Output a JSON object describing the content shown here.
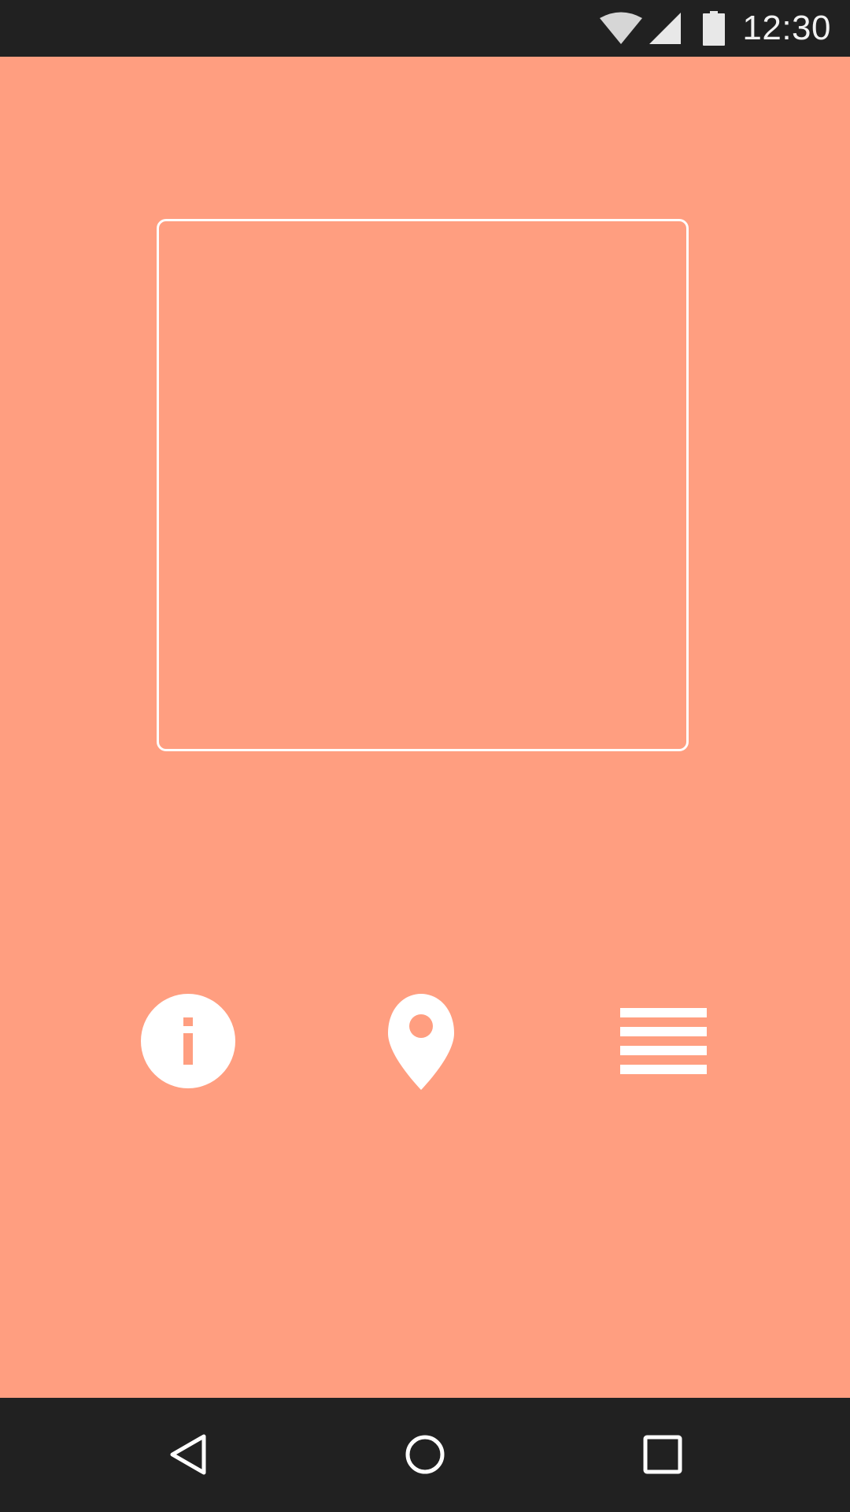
{
  "status_bar": {
    "time": "12:30",
    "icons": [
      "wifi-icon",
      "cellular-signal-icon",
      "battery-icon"
    ]
  },
  "main": {
    "background_color": "#ff9e80",
    "frame_border_color": "#ffffff",
    "actions": [
      {
        "name": "info-button",
        "icon": "info-icon"
      },
      {
        "name": "location-button",
        "icon": "location-pin-icon"
      },
      {
        "name": "menu-button",
        "icon": "menu-lines-icon"
      }
    ]
  },
  "nav_bar": {
    "background_color": "#212121",
    "buttons": [
      {
        "name": "back-button",
        "icon": "back-triangle-icon"
      },
      {
        "name": "home-button",
        "icon": "home-circle-icon"
      },
      {
        "name": "recents-button",
        "icon": "recents-square-icon"
      }
    ]
  }
}
